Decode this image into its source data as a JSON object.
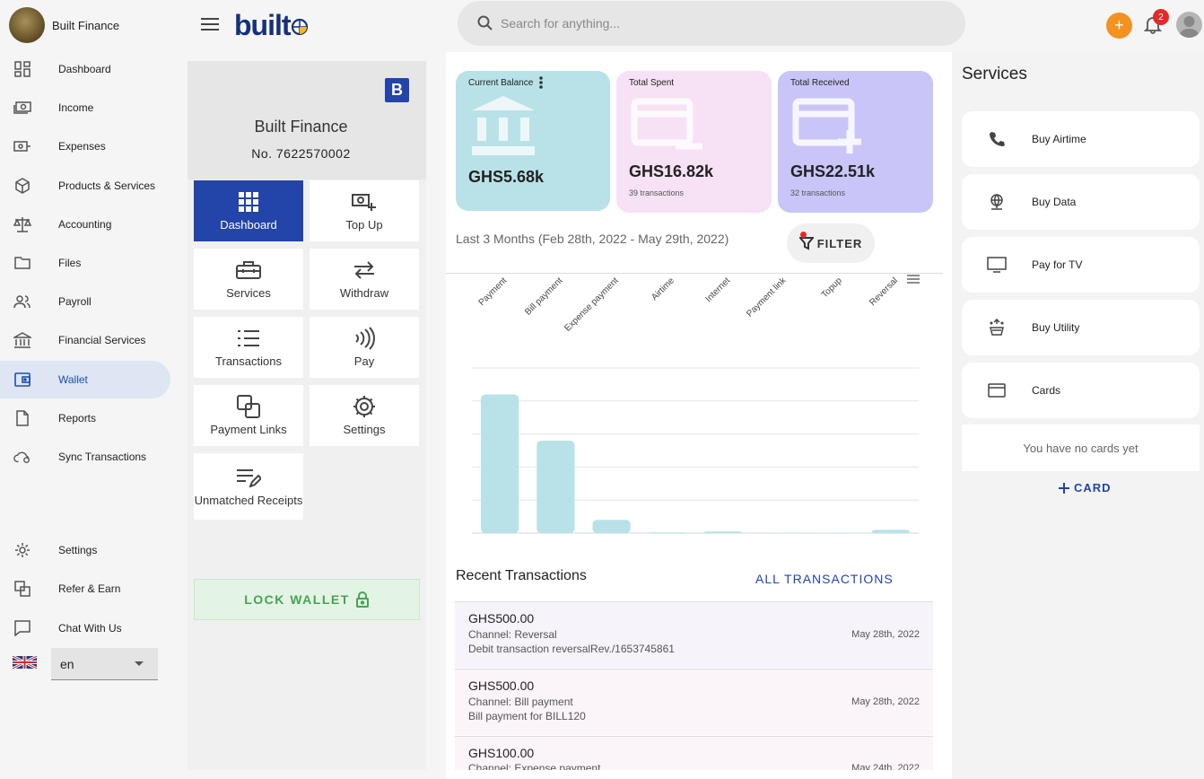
{
  "app": {
    "name": "Built Finance",
    "logo_text": "built"
  },
  "colors": {
    "primary": "#2344a8",
    "accent": "#f39220",
    "balance": "#b8e2e8",
    "spent": "#f7e1f4",
    "received": "#cac5f8",
    "lock_text": "#47a356"
  },
  "sidebar": {
    "items": [
      {
        "label": "Dashboard",
        "icon": "dashboard-icon"
      },
      {
        "label": "Income",
        "icon": "income-icon"
      },
      {
        "label": "Expenses",
        "icon": "expenses-icon"
      },
      {
        "label": "Products & Services",
        "icon": "box-icon"
      },
      {
        "label": "Accounting",
        "icon": "scale-icon"
      },
      {
        "label": "Files",
        "icon": "folder-icon"
      },
      {
        "label": "Payroll",
        "icon": "people-icon"
      },
      {
        "label": "Financial Services",
        "icon": "bank-icon"
      },
      {
        "label": "Wallet",
        "icon": "wallet-icon",
        "active": true
      },
      {
        "label": "Reports",
        "icon": "document-icon"
      },
      {
        "label": "Sync Transactions",
        "icon": "cloud-sync-icon"
      },
      {
        "label": "Settings",
        "icon": "gear-icon"
      },
      {
        "label": "Refer & Earn",
        "icon": "refer-icon"
      },
      {
        "label": "Chat With Us",
        "icon": "chat-icon"
      }
    ],
    "language": "en"
  },
  "topbar": {
    "search_placeholder": "Search for anything...",
    "notification_count": "2"
  },
  "wallet": {
    "title": "Built Finance",
    "badge": "B",
    "number": "No. 7622570002",
    "tiles": [
      {
        "label": "Dashboard",
        "icon": "grid-icon"
      },
      {
        "label": "Top Up",
        "icon": "topup-icon"
      },
      {
        "label": "Services",
        "icon": "toolbox-icon"
      },
      {
        "label": "Withdraw",
        "icon": "swap-arrows-icon"
      },
      {
        "label": "Transactions",
        "icon": "list-icon"
      },
      {
        "label": "Pay",
        "icon": "contactless-icon"
      },
      {
        "label": "Payment Links",
        "icon": "link-copy-icon"
      },
      {
        "label": "Settings",
        "icon": "gear-icon"
      },
      {
        "label": "Unmatched Receipts",
        "icon": "edit-list-icon"
      }
    ],
    "lock_label": "LOCK WALLET"
  },
  "stats": {
    "balance": {
      "label": "Current Balance",
      "value": "GHS5.68k"
    },
    "spent": {
      "label": "Total Spent",
      "value": "GHS16.82k",
      "sub": "39 transactions"
    },
    "received": {
      "label": "Total Received",
      "value": "GHS22.51k",
      "sub": "32 transactions"
    }
  },
  "range_text": "Last 3 Months (Feb 28th, 2022 - May 29th, 2022)",
  "filter_label": "FILTER",
  "chart_data": {
    "type": "bar",
    "categories": [
      "Payment",
      "Bill payment",
      "Expense payment",
      "Airtime",
      "Internet",
      "Payment link",
      "Topup",
      "Reversal"
    ],
    "values": [
      8.4,
      5.6,
      0.8,
      0.05,
      0.1,
      0,
      0.02,
      0.2
    ],
    "ylim": [
      0,
      10
    ],
    "grid": true
  },
  "recent": {
    "title": "Recent Transactions",
    "all_label": "ALL TRANSACTIONS",
    "items": [
      {
        "amount": "GHS500.00",
        "channel": "Channel: Reversal",
        "desc": "Debit transaction reversalRev./1653745861",
        "date": "May 28th, 2022"
      },
      {
        "amount": "GHS500.00",
        "channel": "Channel: Bill payment",
        "desc": "Bill payment for BILL120",
        "date": "May 28th, 2022"
      },
      {
        "amount": "GHS100.00",
        "channel": "Channel: Expense payment",
        "desc": "",
        "date": "May 24th, 2022"
      }
    ]
  },
  "services": {
    "title": "Services",
    "items": [
      {
        "label": "Buy Airtime",
        "icon": "phone-icon"
      },
      {
        "label": "Buy Data",
        "icon": "globe-icon"
      },
      {
        "label": "Pay for TV",
        "icon": "tv-icon"
      },
      {
        "label": "Buy Utility",
        "icon": "utility-icon"
      },
      {
        "label": "Cards",
        "icon": "card-icon"
      }
    ],
    "no_cards": "You have no cards yet",
    "add_card": "CARD"
  }
}
